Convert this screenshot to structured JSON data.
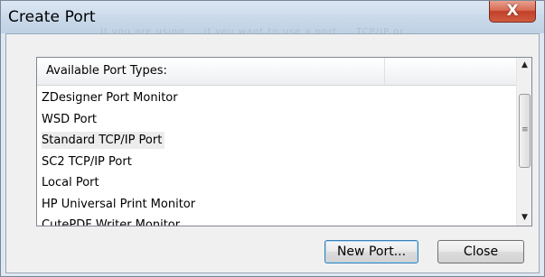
{
  "window": {
    "title": "Create Port",
    "close_glyph": "X",
    "faded_header_text": "If you are using ... If you want to use a port ... TCP/IP or ..."
  },
  "list": {
    "column_header": "Available Port Types:",
    "items": [
      {
        "label": "ZDesigner Port Monitor"
      },
      {
        "label": "WSD Port"
      },
      {
        "label": "Standard TCP/IP Port"
      },
      {
        "label": "SC2 TCP/IP Port"
      },
      {
        "label": "Local Port"
      },
      {
        "label": "HP Universal Print Monitor"
      },
      {
        "label": "CutePDF Writer Monitor"
      }
    ],
    "selected_index": 2
  },
  "scrollbar": {
    "up_glyph": "▲",
    "down_glyph": "▼",
    "grip_glyph": "≡"
  },
  "buttons": {
    "new_port": "New Port...",
    "close": "Close"
  },
  "icons": {
    "close": "close-icon",
    "scroll_up": "chevron-up-icon",
    "scroll_down": "chevron-down-icon"
  }
}
